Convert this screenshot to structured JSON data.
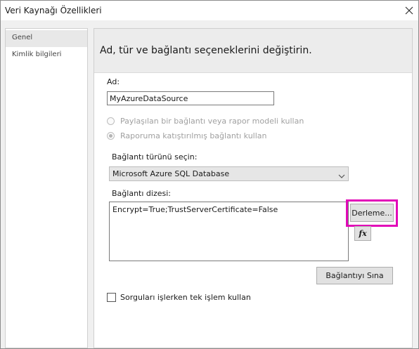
{
  "window": {
    "title": "Veri Kaynağı Özellikleri",
    "close_icon": "close-icon"
  },
  "sidebar": {
    "items": [
      {
        "label": "Genel",
        "selected": true
      },
      {
        "label": "Kimlik bilgileri",
        "selected": false
      }
    ]
  },
  "panel": {
    "header": "Ad, tür ve bağlantı seçeneklerini değiştirin.",
    "name_label": "Ad:",
    "name_value": "MyAzureDataSource",
    "radio_shared": "Paylaşılan bir bağlantı veya rapor modeli kullan",
    "radio_embedded": "Raporuma katıştırılmış bağlantı kullan",
    "type_label": "Bağlantı türünü seçin:",
    "type_value": "Microsoft Azure SQL Database",
    "conn_label": "Bağlantı dizesi:",
    "conn_value": "Encrypt=True;TrustServerCertificate=False",
    "build_button": "Derleme...",
    "expression_button": "fx",
    "test_button": "Bağlantıyı Sına",
    "single_transaction": "Sorguları işlerken tek işlem kullan"
  },
  "colors": {
    "highlight": "#e20ab8",
    "panel_header_bg": "#ececec",
    "window_bg": "#f0f0f0"
  }
}
